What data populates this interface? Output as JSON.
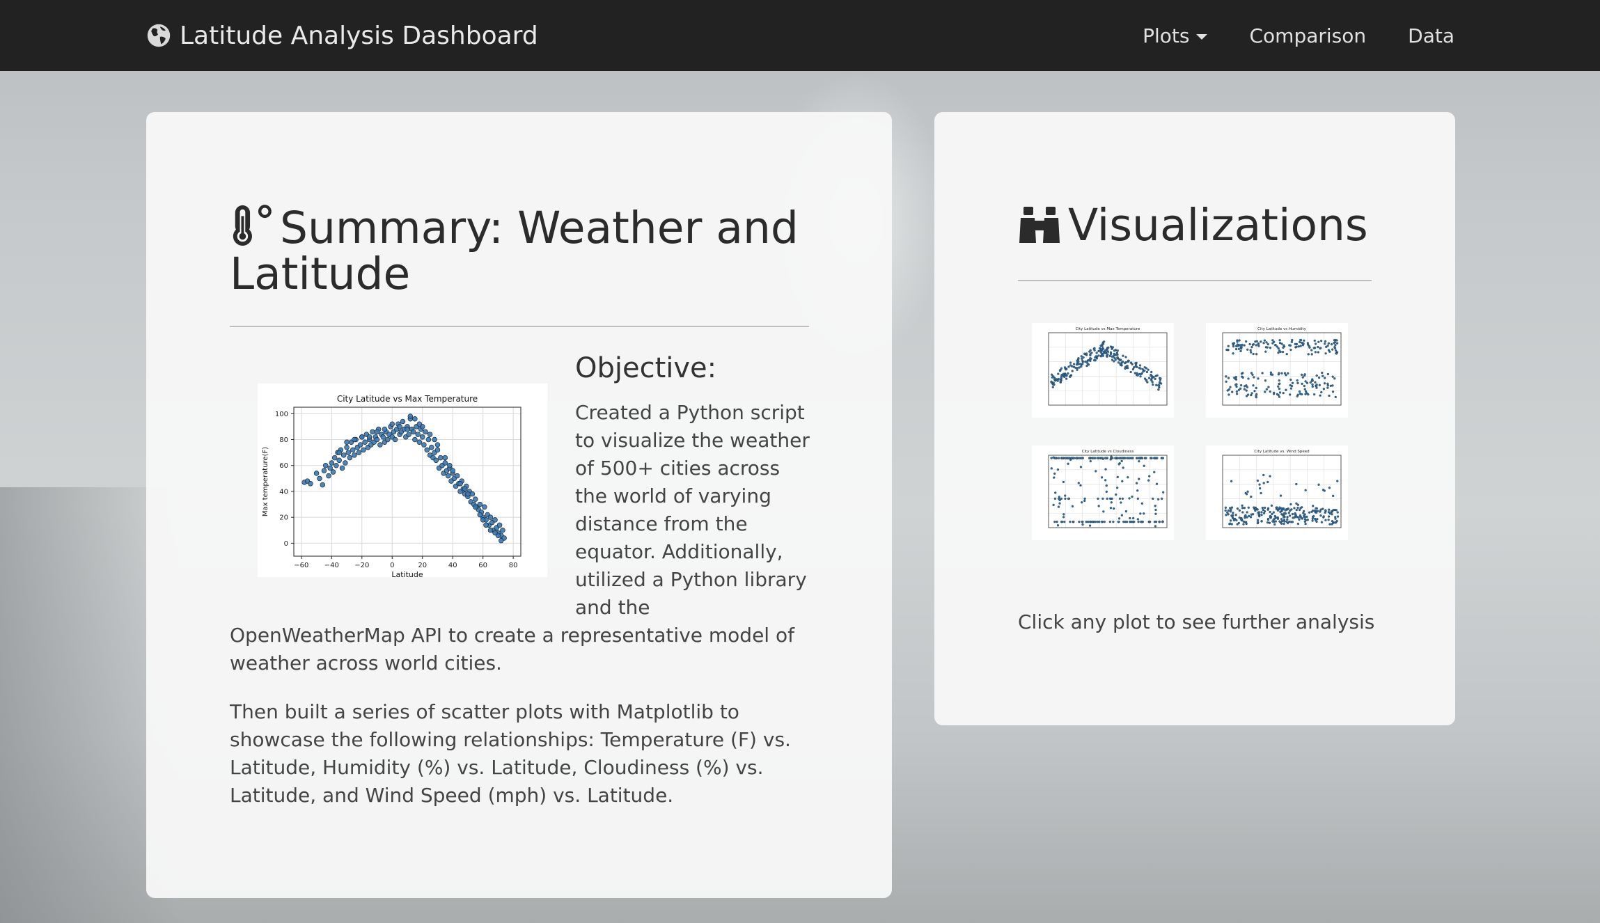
{
  "navbar": {
    "brand": "Latitude Analysis Dashboard",
    "items": [
      "Plots",
      "Comparison",
      "Data"
    ]
  },
  "summary": {
    "title": "Summary: Weather and Latitude",
    "objective_heading": "Objective:",
    "objective_text": "Created a Python script to visualize the weather of 500+ cities across the world of varying distance from the equator. Additionally, utilized a Python library and the",
    "objective_text_tail": "OpenWeatherMap API to create a representative model of weather across world cities.",
    "paragraph2": "Then built a series of scatter plots with Matplotlib to showcase the following relationships: Temperature (F) vs. Latitude, Humidity (%) vs. Latitude, Cloudiness (%) vs. Latitude, and Wind Speed (mph) vs. Latitude."
  },
  "visualizations": {
    "title": "Visualizations",
    "hint": "Click any plot to see further analysis",
    "thumbnails": [
      "City Latitude vs Max Temperature",
      "City Latitude vs Humidity",
      "City Latitude vs Cloudiness",
      "City Latitude vs. Wind Speed"
    ]
  },
  "chart_data": {
    "type": "scatter",
    "title": "City Latitude vs Max Temperature",
    "xlabel": "Latitude",
    "ylabel": "Max temperature(F)",
    "xlim": [
      -65,
      85
    ],
    "ylim": [
      -10,
      105
    ],
    "xticks": [
      -60,
      -40,
      -20,
      0,
      20,
      40,
      60,
      80
    ],
    "yticks": [
      0,
      20,
      40,
      60,
      80,
      100
    ],
    "grid": true,
    "point_color": "#3a78b0",
    "x": [
      -58,
      -56,
      -54,
      -50,
      -48,
      -46,
      -45,
      -44,
      -42,
      -41,
      -40,
      -39,
      -38,
      -37,
      -36,
      -35,
      -34,
      -33,
      -32,
      -31,
      -30,
      -29,
      -28,
      -27,
      -26,
      -25,
      -24,
      -23,
      -22,
      -21,
      -20,
      -19,
      -18,
      -17,
      -16,
      -15,
      -14,
      -13,
      -12,
      -11,
      -10,
      -9,
      -8,
      -7,
      -6,
      -5,
      -4,
      -3,
      -2,
      -1,
      0,
      1,
      2,
      3,
      4,
      5,
      6,
      7,
      8,
      9,
      10,
      11,
      12,
      13,
      14,
      15,
      16,
      17,
      18,
      19,
      20,
      21,
      22,
      23,
      24,
      25,
      26,
      27,
      28,
      29,
      30,
      31,
      32,
      33,
      34,
      35,
      36,
      37,
      38,
      39,
      40,
      41,
      42,
      43,
      44,
      45,
      46,
      47,
      48,
      49,
      50,
      51,
      52,
      53,
      54,
      55,
      56,
      57,
      58,
      59,
      60,
      61,
      62,
      63,
      64,
      65,
      66,
      67,
      68,
      69,
      70,
      71,
      72,
      73,
      74,
      -30,
      -20,
      -10,
      0,
      10,
      15,
      20,
      25,
      30,
      35,
      40,
      45,
      50,
      55,
      60,
      65,
      70,
      -35,
      -25,
      -15,
      -5,
      5,
      12,
      18,
      28,
      38,
      48,
      58,
      62,
      68,
      72
    ],
    "y": [
      47,
      48,
      46,
      54,
      50,
      45,
      56,
      60,
      52,
      58,
      62,
      55,
      66,
      60,
      70,
      64,
      72,
      58,
      68,
      62,
      74,
      70,
      66,
      78,
      72,
      68,
      80,
      74,
      70,
      76,
      82,
      72,
      78,
      84,
      74,
      80,
      76,
      86,
      78,
      82,
      80,
      88,
      76,
      84,
      82,
      78,
      86,
      80,
      84,
      90,
      82,
      86,
      80,
      88,
      92,
      84,
      86,
      94,
      88,
      82,
      90,
      84,
      96,
      88,
      86,
      80,
      90,
      84,
      78,
      88,
      82,
      76,
      86,
      72,
      80,
      68,
      74,
      66,
      70,
      64,
      72,
      58,
      66,
      60,
      54,
      62,
      56,
      52,
      58,
      48,
      54,
      50,
      44,
      52,
      46,
      40,
      48,
      42,
      38,
      44,
      36,
      40,
      32,
      38,
      30,
      34,
      28,
      26,
      30,
      24,
      20,
      28,
      18,
      22,
      14,
      20,
      16,
      10,
      18,
      12,
      8,
      14,
      6,
      10,
      4,
      78,
      82,
      86,
      92,
      88,
      96,
      90,
      84,
      76,
      66,
      56,
      46,
      38,
      28,
      18,
      10,
      6,
      70,
      80,
      82,
      88,
      90,
      98,
      92,
      80,
      60,
      42,
      22,
      14,
      8,
      2
    ]
  }
}
